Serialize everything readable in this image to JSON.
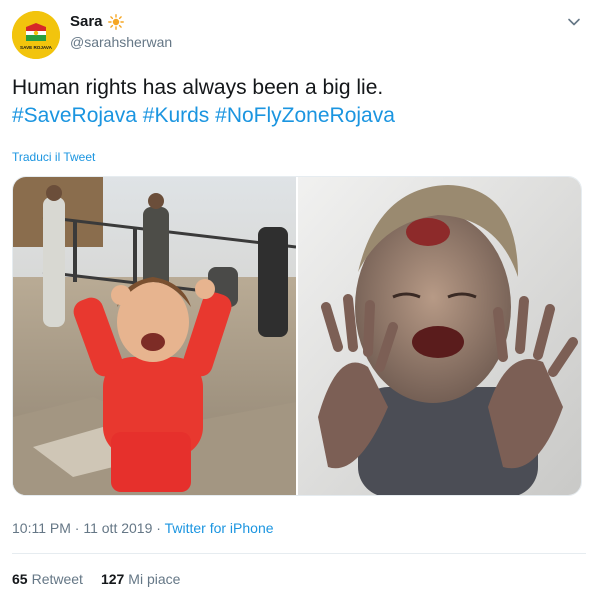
{
  "user": {
    "display_name": "Sara",
    "emoji": "☀",
    "handle": "@sarahsherwan",
    "avatar_text": "SAVE ROJAVA"
  },
  "tweet": {
    "line1": "Human rights has always been a big lie.",
    "hashtags": [
      "#SaveRojava",
      "#Kurds",
      "#NoFlyZoneRojava"
    ],
    "translate_label": "Traduci il Tweet"
  },
  "meta": {
    "time": "10:11 PM",
    "separator1": " · ",
    "date": "11 ott 2019",
    "separator2": " · ",
    "source": "Twitter for iPhone"
  },
  "stats": {
    "retweets_count": "65",
    "retweets_label": "Retweet",
    "likes_count": "127",
    "likes_label": "Mi piace"
  },
  "icons": {
    "chevron": "chevron-down-icon",
    "sun": "sun-icon"
  },
  "colors": {
    "link": "#1b95e0",
    "secondary_text": "#657786",
    "avatar_bg": "#f2c40d"
  }
}
